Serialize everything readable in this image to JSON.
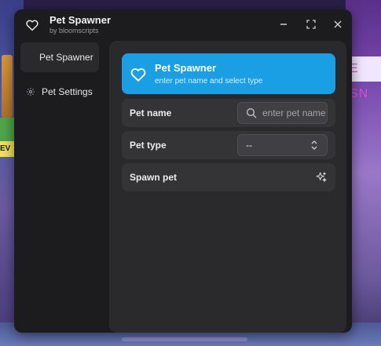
{
  "window": {
    "title": "Pet Spawner",
    "subtitle": "by bloomscripts",
    "icons": [
      "heart-icon",
      "minimize-icon",
      "maximize-icon",
      "close-icon"
    ]
  },
  "sidebar": {
    "items": [
      {
        "label": "Pet Spawner",
        "active": true
      },
      {
        "label": "Pet Settings",
        "icon": "gear-icon",
        "active": false
      }
    ]
  },
  "hero": {
    "title": "Pet Spawner",
    "subtitle": "enter pet name and select type",
    "icon": "heart-icon",
    "color": "#1b9fe4"
  },
  "rows": {
    "pet_name": {
      "label": "Pet name",
      "placeholder": "enter pet name",
      "value": ""
    },
    "pet_type": {
      "label": "Pet type",
      "value": "--"
    },
    "spawn": {
      "label": "Spawn pet",
      "icon": "sparkles-icon"
    }
  },
  "background": {
    "sign_text": "E SN",
    "ev_text": "EV"
  },
  "colors": {
    "window_bg": "#1c1c1e",
    "panel_bg": "#2a2a2c",
    "row_bg": "#343437",
    "accent": "#1b9fe4"
  }
}
